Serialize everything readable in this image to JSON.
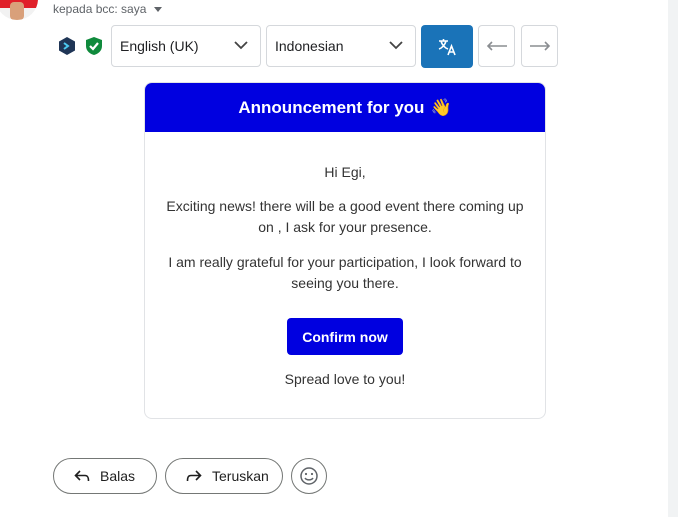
{
  "header": {
    "recipient_text": "kepada bcc: saya"
  },
  "translate_bar": {
    "source_language": "English (UK)",
    "target_language": "Indonesian",
    "translate_icon": "translate-icon",
    "back_icon": "arrow-left-icon",
    "forward_icon": "arrow-right-icon"
  },
  "email": {
    "banner_title": "Announcement for you",
    "banner_emoji": "👋",
    "greeting": "Hi Egi,",
    "paragraph_1": "Exciting news! there will be a good event there coming up on , I ask for your presence.",
    "paragraph_2": "I am really grateful for your participation, I look forward to seeing you there.",
    "cta_label": "Confirm now",
    "closing": "Spread love to you!",
    "colors": {
      "banner": "#0000e0",
      "cta": "#0000e0"
    }
  },
  "actions": {
    "reply_label": "Balas",
    "forward_label": "Teruskan",
    "emoji_icon": "smiley-icon"
  },
  "colors": {
    "translate_button": "#1a73b8",
    "shield": "#0f8a3c"
  }
}
